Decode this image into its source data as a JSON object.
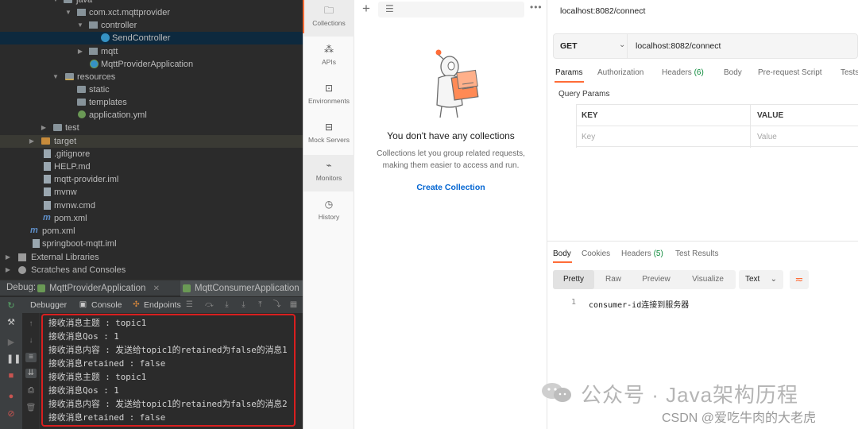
{
  "ide": {
    "tree": [
      {
        "label": "java",
        "icon": "folder-icon"
      },
      {
        "label": "com.xct.mqttprovider",
        "icon": "package-icon"
      },
      {
        "label": "controller",
        "icon": "package-icon"
      },
      {
        "label": "SendController",
        "icon": "class-icon"
      },
      {
        "label": "mqtt",
        "icon": "package-icon"
      },
      {
        "label": "MqttProviderApplication",
        "icon": "spring-class-icon"
      },
      {
        "label": "resources",
        "icon": "resources-folder-icon"
      },
      {
        "label": "static",
        "icon": "folder-icon"
      },
      {
        "label": "templates",
        "icon": "folder-icon"
      },
      {
        "label": "application.yml",
        "icon": "yaml-icon"
      },
      {
        "label": "test",
        "icon": "folder-icon"
      },
      {
        "label": "target",
        "icon": "folder-icon"
      },
      {
        "label": ".gitignore",
        "icon": "file-icon"
      },
      {
        "label": "HELP.md",
        "icon": "file-icon"
      },
      {
        "label": "mqtt-provider.iml",
        "icon": "file-icon"
      },
      {
        "label": "mvnw",
        "icon": "file-icon"
      },
      {
        "label": "mvnw.cmd",
        "icon": "file-icon"
      },
      {
        "label": "pom.xml",
        "icon": "maven-icon"
      },
      {
        "label": "pom.xml",
        "icon": "maven-icon"
      },
      {
        "label": "springboot-mqtt.iml",
        "icon": "file-icon"
      },
      {
        "label": "External Libraries",
        "icon": "library-icon"
      },
      {
        "label": "Scratches and Consoles",
        "icon": "scratch-icon"
      }
    ],
    "debug_label": "Debug:",
    "run_tabs": [
      "MqttProviderApplication",
      "MqttConsumerApplication"
    ],
    "debug_tabs": [
      "Debugger",
      "Console",
      "Endpoints"
    ],
    "console_lines": [
      "接收消息主题 : topic1",
      "接收消息Qos : 1",
      "接收消息内容 : 发送给topic1的retained为false的消息1",
      "接收消息retained : false",
      "接收消息主题 : topic1",
      "接收消息Qos : 1",
      "接收消息内容 : 发送给topic1的retained为false的消息2",
      "接收消息retained : false"
    ]
  },
  "postman": {
    "sidebar": [
      {
        "label": "Collections",
        "icon": "collections-icon"
      },
      {
        "label": "APIs",
        "icon": "apis-icon"
      },
      {
        "label": "Environments",
        "icon": "environments-icon"
      },
      {
        "label": "Mock Servers",
        "icon": "mock-servers-icon"
      },
      {
        "label": "Monitors",
        "icon": "monitors-icon"
      },
      {
        "label": "History",
        "icon": "history-icon"
      }
    ],
    "collections": {
      "empty_title": "You don't have any collections",
      "empty_desc": "Collections let you group related requests, making them easier to access and run.",
      "create_link": "Create Collection"
    },
    "request": {
      "title": "localhost:8082/connect",
      "method": "GET",
      "url": "localhost:8082/connect",
      "tabs": [
        {
          "label": "Params",
          "count": ""
        },
        {
          "label": "Authorization",
          "count": ""
        },
        {
          "label": "Headers",
          "count": "(6)"
        },
        {
          "label": "Body",
          "count": ""
        },
        {
          "label": "Pre-request Script",
          "count": ""
        },
        {
          "label": "Tests",
          "count": ""
        }
      ],
      "query_params_label": "Query Params",
      "key_header": "KEY",
      "value_header": "VALUE",
      "key_placeholder": "Key",
      "value_placeholder": "Value"
    },
    "response": {
      "tabs": [
        {
          "label": "Body",
          "count": ""
        },
        {
          "label": "Cookies",
          "count": ""
        },
        {
          "label": "Headers",
          "count": "(5)"
        },
        {
          "label": "Test Results",
          "count": ""
        }
      ],
      "formats": [
        "Pretty",
        "Raw",
        "Preview",
        "Visualize"
      ],
      "text_select": "Text",
      "line_number": "1",
      "body_text": "consumer-id连接到服务器"
    },
    "accent_color": "#ff6c37"
  },
  "watermark": {
    "main": "公众号 · Java架构历程",
    "sub": "CSDN @爱吃牛肉的大老虎"
  }
}
